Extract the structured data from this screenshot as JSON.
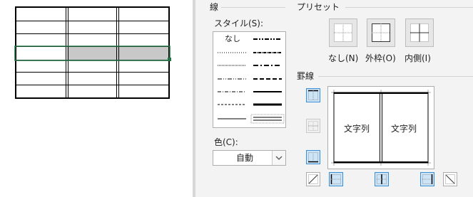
{
  "dialog": {
    "line_section": {
      "title": "線",
      "style_label": "スタイル(S):",
      "style_none": "なし",
      "color_label": "色(C):",
      "color_value": "自動"
    },
    "preset_section": {
      "title": "プリセット",
      "buttons": [
        {
          "label": "なし(N)",
          "icon": "preset-none-icon"
        },
        {
          "label": "外枠(O)",
          "icon": "preset-outline-icon"
        },
        {
          "label": "内側(I)",
          "icon": "preset-inside-icon"
        }
      ]
    },
    "border_section": {
      "title": "罫線",
      "preview_texts": [
        "文字列",
        "文字列"
      ]
    }
  },
  "colors": {
    "dialog_bg": "#f3f3f3",
    "selection_border": "#217346",
    "selection_fill": "#c8c8c8",
    "active_button": "#cce4f7"
  }
}
